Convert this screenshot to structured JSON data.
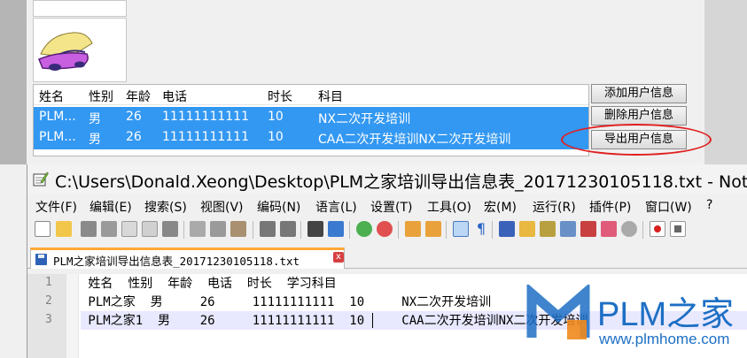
{
  "dialog": {
    "columns": [
      "姓名",
      "性别",
      "年龄",
      "电话",
      "时长",
      "科目"
    ],
    "rows": [
      [
        "PLM...",
        "男",
        "26",
        "11111111111",
        "10",
        "NX二次开发培训"
      ],
      [
        "PLM...",
        "男",
        "26",
        "11111111111",
        "10",
        "CAA二次开发培训NX二次开发培训"
      ]
    ],
    "buttons": {
      "add": "添加用户信息",
      "delete": "删除用户信息",
      "export": "导出用户信息"
    },
    "highlight_color": "#e02020",
    "selection_color": "#3398f2"
  },
  "npp": {
    "title": "C:\\Users\\Donald.Xeong\\Desktop\\PLM之家培训导出信息表_20171230105118.txt - Not...",
    "menu": [
      "文件(F)",
      "编辑(E)",
      "搜索(S)",
      "视图(V)",
      "编码(N)",
      "语言(L)",
      "设置(T)",
      "工具(O)",
      "宏(M)",
      "运行(R)",
      "插件(P)",
      "窗口(W)",
      "?"
    ],
    "toolbar_icons": [
      "new-file-icon",
      "open-file-icon",
      "save-icon",
      "save-all-icon",
      "close-icon",
      "close-all-icon",
      "print-icon",
      "cut-icon",
      "copy-icon",
      "paste-icon",
      "undo-icon",
      "redo-icon",
      "find-icon",
      "replace-icon",
      "zoom-in-icon",
      "zoom-out-icon",
      "sync-v-icon",
      "sync-h-icon",
      "word-wrap-icon",
      "show-all-chars-icon",
      "indent-guide-icon",
      "doc-map-icon",
      "function-list-icon",
      "folder-workspace-icon",
      "macro-icon",
      "monitor-icon",
      "eye-icon",
      "record-macro-icon",
      "stop-record-icon"
    ],
    "tab": {
      "label": "PLM之家培训导出信息表_20171230105118.txt",
      "close": "x"
    },
    "lines": [
      {
        "n": "1",
        "text": " 姓名  性别  年龄  电话  时长  学习科目"
      },
      {
        "n": "2",
        "text": " PLM之家  男     26     11111111111  10     NX二次开发培训"
      },
      {
        "n": "3",
        "text": " PLM之家1  男    26     11111111111  10     CAA二次开发培训NX二次开发培训"
      }
    ]
  },
  "watermark": {
    "brand": "PLM之家",
    "url": "www.plmhome.com",
    "color": "#1d6fc4"
  }
}
